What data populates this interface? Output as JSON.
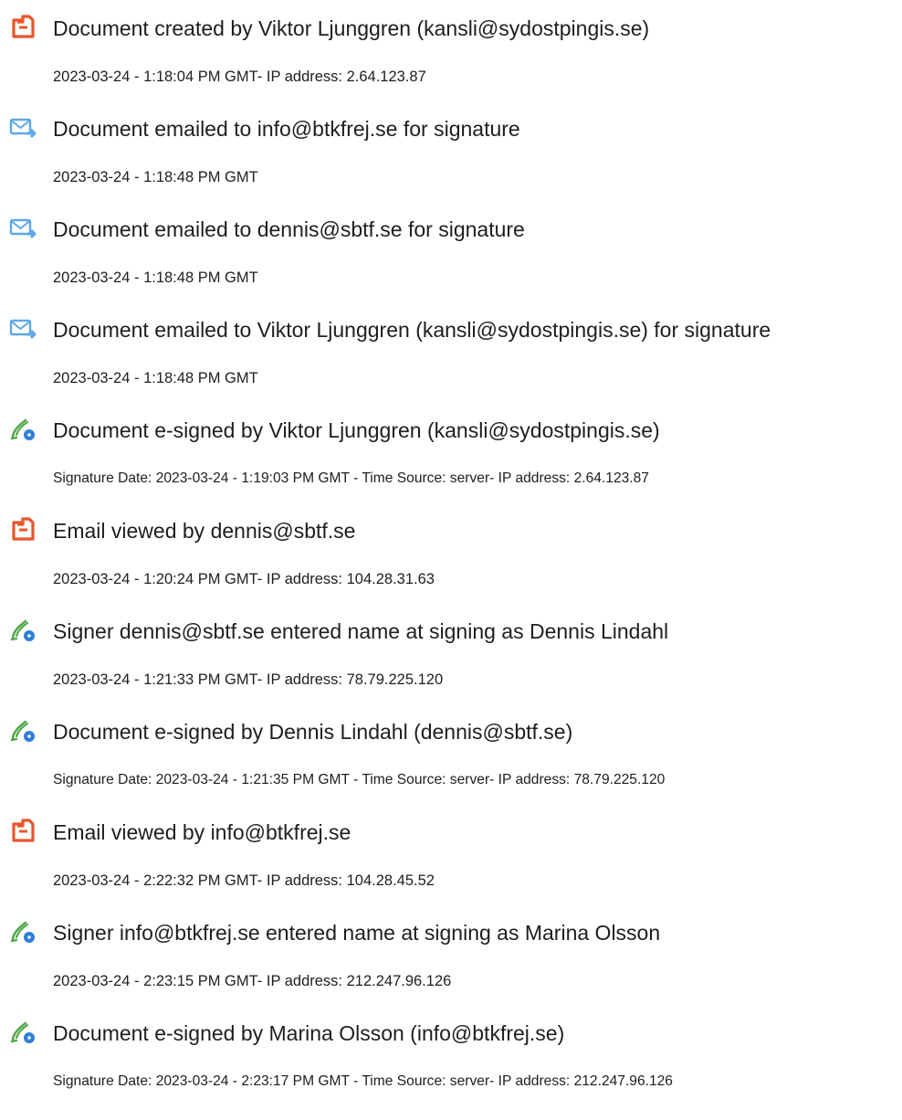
{
  "icons": {
    "created": "document-add-icon",
    "emailed": "email-send-icon",
    "signed": "esign-pen-icon",
    "viewed": "document-view-icon"
  },
  "colors": {
    "created_icon": "#e8562c",
    "emailed_icon": "#5ea8e8",
    "signed_pen": "#52a84a",
    "signed_badge": "#2f7fd8",
    "text": "#1e1e1e"
  },
  "events": [
    {
      "type": "created",
      "title": "Document created by Viktor Ljunggren (kansli@sydostpingis.se)",
      "detail": "2023-03-24 - 1:18:04 PM GMT- IP address: 2.64.123.87"
    },
    {
      "type": "emailed",
      "title": "Document emailed to info@btkfrej.se for signature",
      "detail": "2023-03-24 - 1:18:48 PM GMT"
    },
    {
      "type": "emailed",
      "title": "Document emailed to dennis@sbtf.se for signature",
      "detail": "2023-03-24 - 1:18:48 PM GMT"
    },
    {
      "type": "emailed",
      "title": "Document emailed to Viktor Ljunggren (kansli@sydostpingis.se) for signature",
      "detail": "2023-03-24 - 1:18:48 PM GMT"
    },
    {
      "type": "signed",
      "title": "Document e-signed by Viktor Ljunggren (kansli@sydostpingis.se)",
      "detail": "Signature Date: 2023-03-24 - 1:19:03 PM GMT - Time Source: server- IP address: 2.64.123.87"
    },
    {
      "type": "viewed",
      "title": "Email viewed by dennis@sbtf.se",
      "detail": "2023-03-24 - 1:20:24 PM GMT- IP address: 104.28.31.63"
    },
    {
      "type": "signed",
      "title": "Signer dennis@sbtf.se entered name at signing as Dennis Lindahl",
      "detail": "2023-03-24 - 1:21:33 PM GMT- IP address: 78.79.225.120"
    },
    {
      "type": "signed",
      "title": "Document e-signed by Dennis Lindahl (dennis@sbtf.se)",
      "detail": "Signature Date: 2023-03-24 - 1:21:35 PM GMT - Time Source: server- IP address: 78.79.225.120"
    },
    {
      "type": "viewed",
      "title": "Email viewed by info@btkfrej.se",
      "detail": "2023-03-24 - 2:22:32 PM GMT- IP address: 104.28.45.52"
    },
    {
      "type": "signed",
      "title": "Signer info@btkfrej.se entered name at signing as Marina Olsson",
      "detail": "2023-03-24 - 2:23:15 PM GMT- IP address: 212.247.96.126"
    },
    {
      "type": "signed",
      "title": "Document e-signed by Marina Olsson (info@btkfrej.se)",
      "detail": "Signature Date: 2023-03-24 - 2:23:17 PM GMT - Time Source: server- IP address: 212.247.96.126"
    }
  ]
}
